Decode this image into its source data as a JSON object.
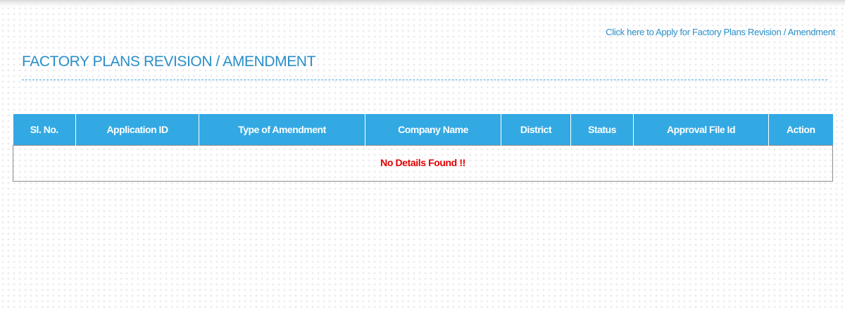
{
  "header": {
    "apply_link": "Click here to Apply for Factory Plans Revision / Amendment",
    "title": "FACTORY PLANS REVISION / AMENDMENT"
  },
  "table": {
    "columns": [
      "Sl. No.",
      "Application ID",
      "Type of Amendment",
      "Company Name",
      "District",
      "Status",
      "Approval File Id",
      "Action"
    ],
    "empty_message": "No Details Found !!"
  },
  "colors": {
    "accent": "#2a8fc8",
    "table_header": "#33a9e3",
    "empty_text": "#e00000"
  }
}
